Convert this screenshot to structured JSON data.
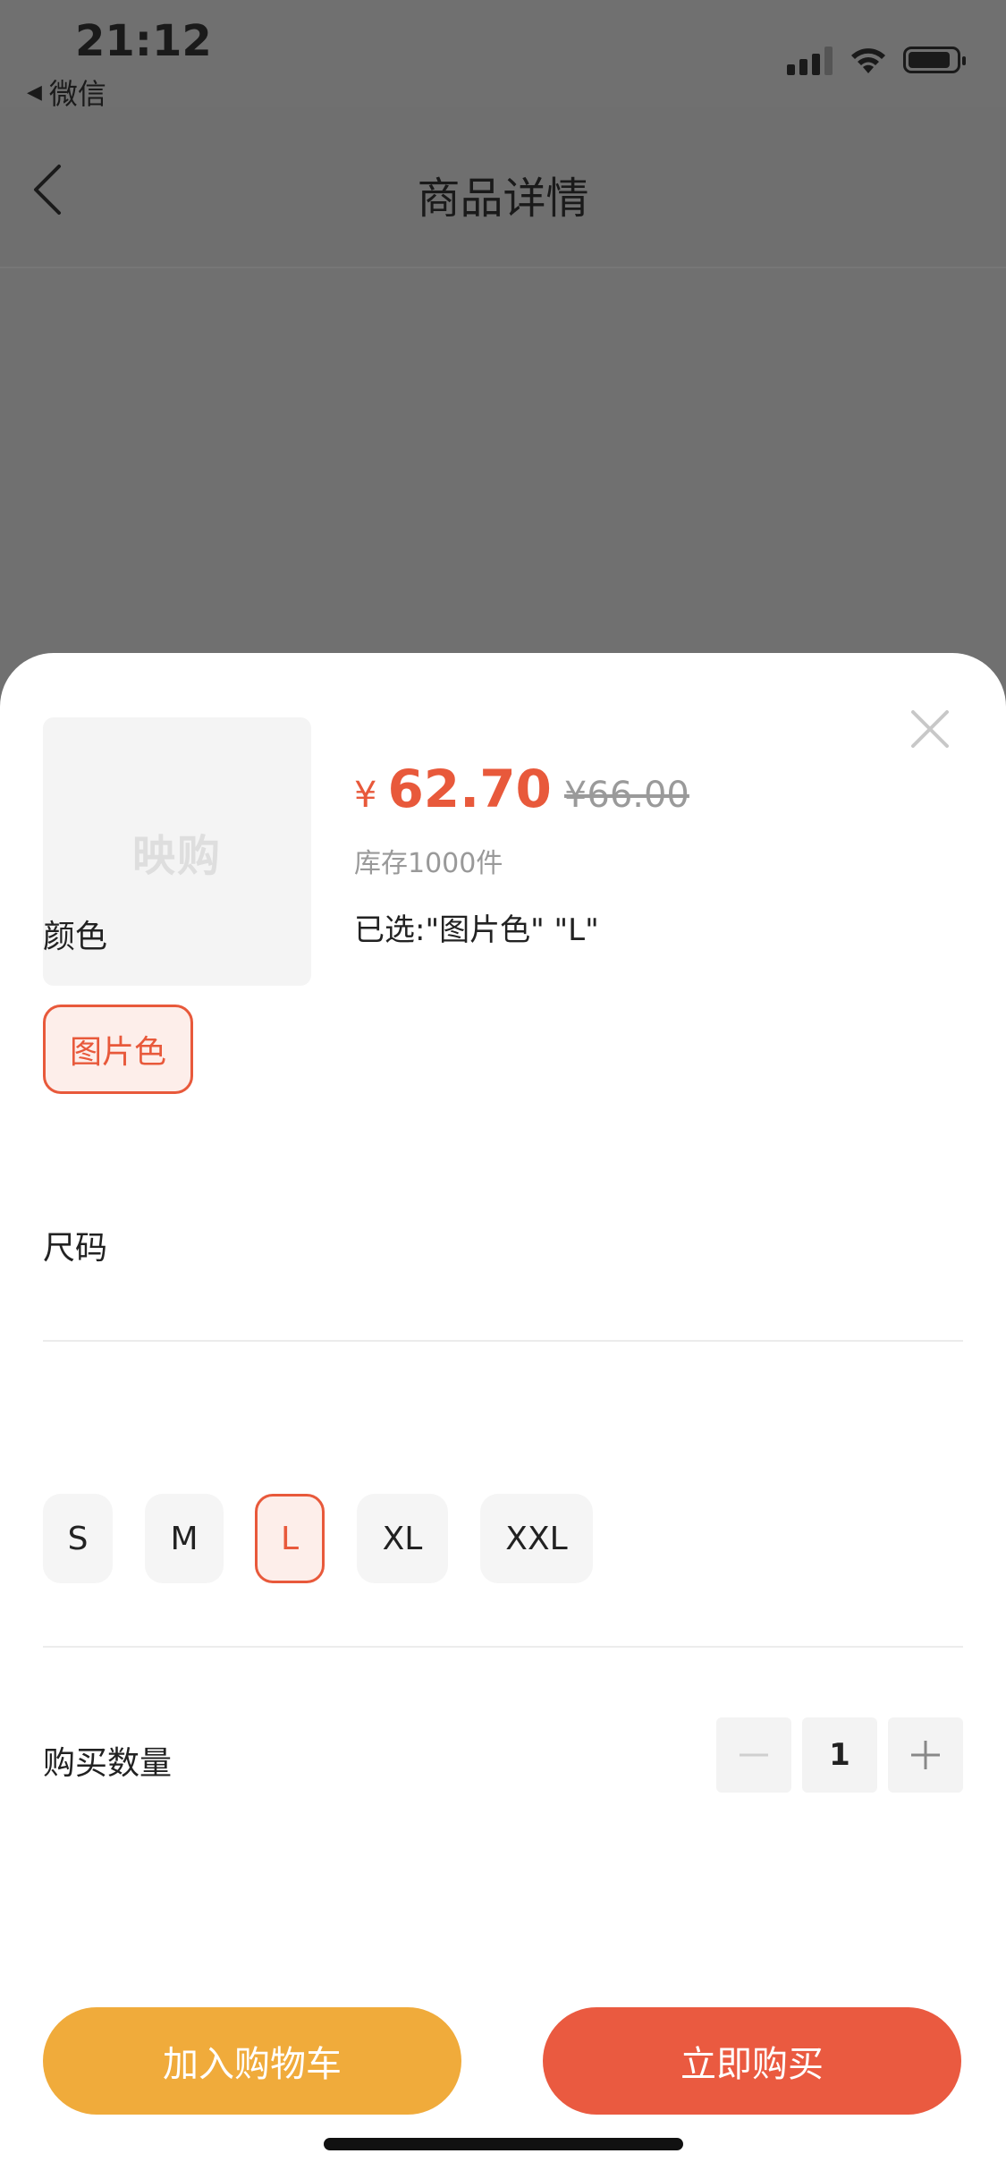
{
  "status_bar": {
    "time": "21:12",
    "back_app": "微信",
    "back_icon": "triangle-left-icon"
  },
  "nav": {
    "title": "商品详情",
    "back_icon": "chevron-left-icon"
  },
  "sheet": {
    "close_icon": "close-icon",
    "thumbnail_logo": "映购",
    "price_symbol": "¥",
    "price": "62.70",
    "original_price": "¥66.00",
    "stock": "库存1000件",
    "selected": "已选:\"图片色\" \"L\"",
    "color_section": {
      "label": "颜色",
      "options": [
        {
          "label": "图片色",
          "selected": true
        }
      ]
    },
    "size_section": {
      "label": "尺码",
      "options": [
        {
          "label": "S",
          "selected": false
        },
        {
          "label": "M",
          "selected": false
        },
        {
          "label": "L",
          "selected": true
        },
        {
          "label": "XL",
          "selected": false
        },
        {
          "label": "XXL",
          "selected": false
        }
      ]
    },
    "quantity": {
      "label": "购买数量",
      "value": "1",
      "minus_icon": "minus-icon",
      "plus_icon": "plus-icon"
    },
    "buttons": {
      "add_to_cart": "加入购物车",
      "buy_now": "立即购买"
    }
  },
  "colors": {
    "accent": "#e8593b",
    "cart_button": "#f0ab3b",
    "buy_button": "#ea5a40"
  }
}
